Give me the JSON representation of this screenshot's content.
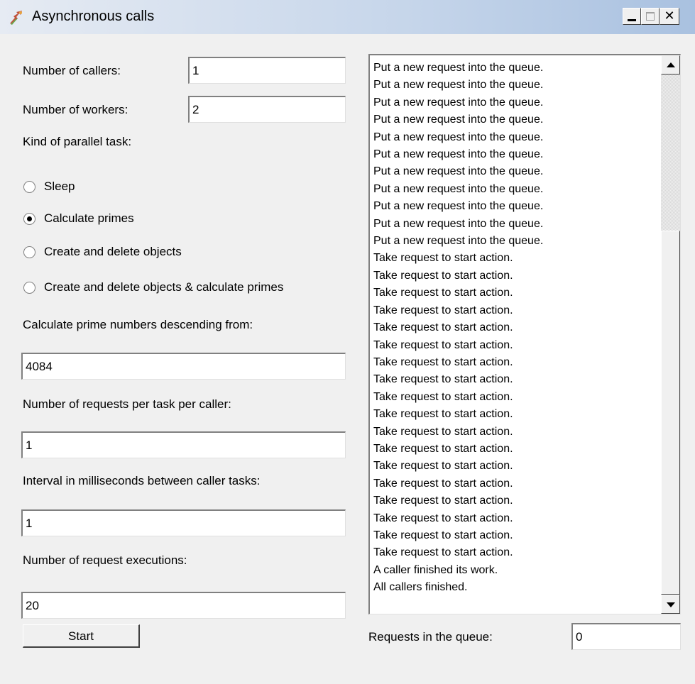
{
  "window": {
    "title": "Asynchronous calls",
    "icon": "app-icon"
  },
  "form": {
    "callers_label": "Number of callers:",
    "callers_value": "1",
    "workers_label": "Number of workers:",
    "workers_value": "2",
    "task_kind_label": "Kind of parallel task:",
    "options": [
      {
        "label": "Sleep",
        "checked": false
      },
      {
        "label": "Calculate primes",
        "checked": true
      },
      {
        "label": "Create and delete objects",
        "checked": false
      },
      {
        "label": "Create and delete objects & calculate primes",
        "checked": false
      }
    ],
    "primes_label": "Calculate prime numbers descending from:",
    "primes_value": "4084",
    "requests_label": "Number of requests per task per caller:",
    "requests_value": "1",
    "interval_label": "Interval in milliseconds between caller tasks:",
    "interval_value": "1",
    "executions_label": "Number of request executions:",
    "executions_value": "20",
    "start_label": "Start"
  },
  "log": {
    "items": [
      "Put a new request into the queue.",
      "Put a new request into the queue.",
      "Put a new request into the queue.",
      "Put a new request into the queue.",
      "Put a new request into the queue.",
      "Put a new request into the queue.",
      "Put a new request into the queue.",
      "Put a new request into the queue.",
      "Put a new request into the queue.",
      "Put a new request into the queue.",
      "Put a new request into the queue.",
      "Take request to start action.",
      "Take request to start action.",
      "Take request to start action.",
      "Take request to start action.",
      "Take request to start action.",
      "Take request to start action.",
      "Take request to start action.",
      "Take request to start action.",
      "Take request to start action.",
      "Take request to start action.",
      "Take request to start action.",
      "Take request to start action.",
      "Take request to start action.",
      "Take request to start action.",
      "Take request to start action.",
      "Take request to start action.",
      "Take request to start action.",
      "Take request to start action.",
      "A caller finished its work.",
      "All callers finished."
    ]
  },
  "queue": {
    "label": "Requests in the queue:",
    "value": "0"
  }
}
